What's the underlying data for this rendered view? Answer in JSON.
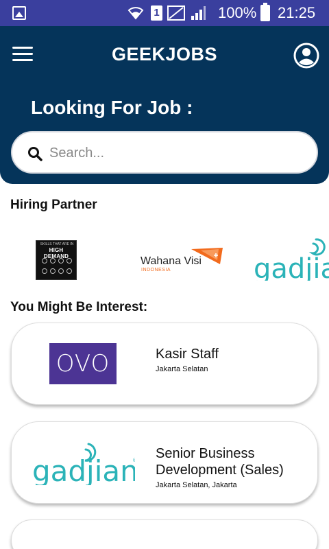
{
  "status_bar": {
    "sim_label": "1",
    "battery": "100%",
    "time": "21:25"
  },
  "header": {
    "title": "GEEKJOBS",
    "heading": "Looking For Job :",
    "search": {
      "placeholder": "Search...",
      "value": ""
    }
  },
  "hiring_partners": {
    "title": "Hiring Partner",
    "partners": [
      {
        "name": "HIGH DEMAND",
        "tagline": "SKILLS THAT ARE IN"
      },
      {
        "name": "Wahana Visi",
        "sub": "INDONESIA"
      },
      {
        "name": "gadjian"
      }
    ]
  },
  "interests": {
    "title": "You Might Be Interest:",
    "jobs": [
      {
        "company": "OVO",
        "title": "Kasir Staff",
        "location": "Jakarta Selatan"
      },
      {
        "company": "gadjian",
        "title": "Senior Business Development (Sales)",
        "location": "Jakarta Selatan, Jakarta"
      }
    ]
  },
  "colors": {
    "status_bar": "#3a3f9e",
    "header": "#05345a",
    "ovo": "#4c3494",
    "gadjian": "#2bb3b8",
    "wahana_orange": "#f26b1d"
  }
}
